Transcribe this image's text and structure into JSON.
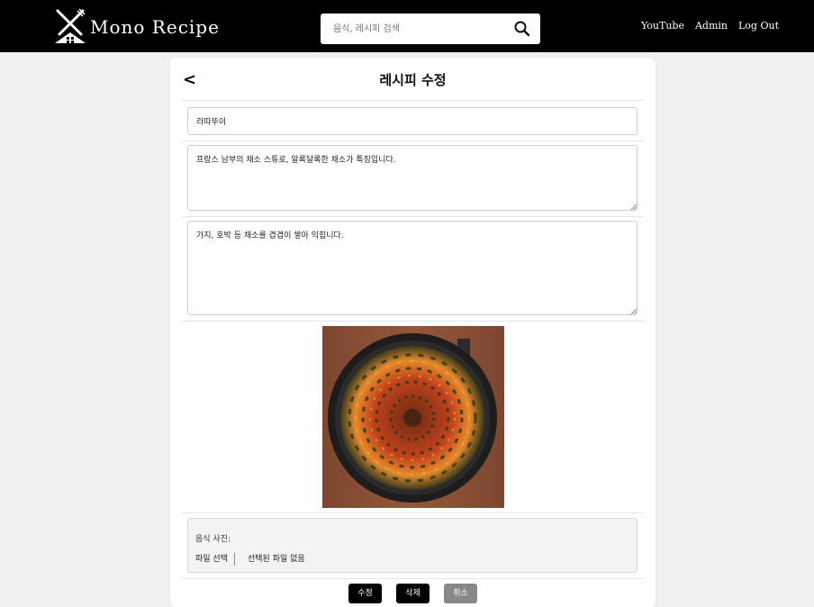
{
  "header": {
    "logo_text": "Mono Recipe",
    "search_placeholder": "음식, 레시피 검색",
    "nav": [
      "YouTube",
      "Admin",
      "Log Out"
    ]
  },
  "page": {
    "back": "<",
    "title": "레시피 수정"
  },
  "form": {
    "name_value": "라따뚜이",
    "description_value": "프랑스 남부의 채소 스튜로, 알록달록한 채소가 특징입니다.",
    "instructions_value": "가지, 호박 등 채소를 겹겹이 쌓아 익힙니다.",
    "photo_label": "음식 사진:",
    "file_choose_label": "파일 선택",
    "file_none_label": "선택된 파일 없음"
  },
  "buttons": {
    "edit": "수정",
    "delete": "삭제",
    "cancel": "취소"
  },
  "colors": {
    "header_bg": "#000000",
    "page_bg": "#f0f0f0",
    "primary_button": "#000000",
    "cancel_button": "#888888"
  },
  "icons": {
    "logo": "fork-knife-house-icon",
    "search": "search-icon"
  }
}
